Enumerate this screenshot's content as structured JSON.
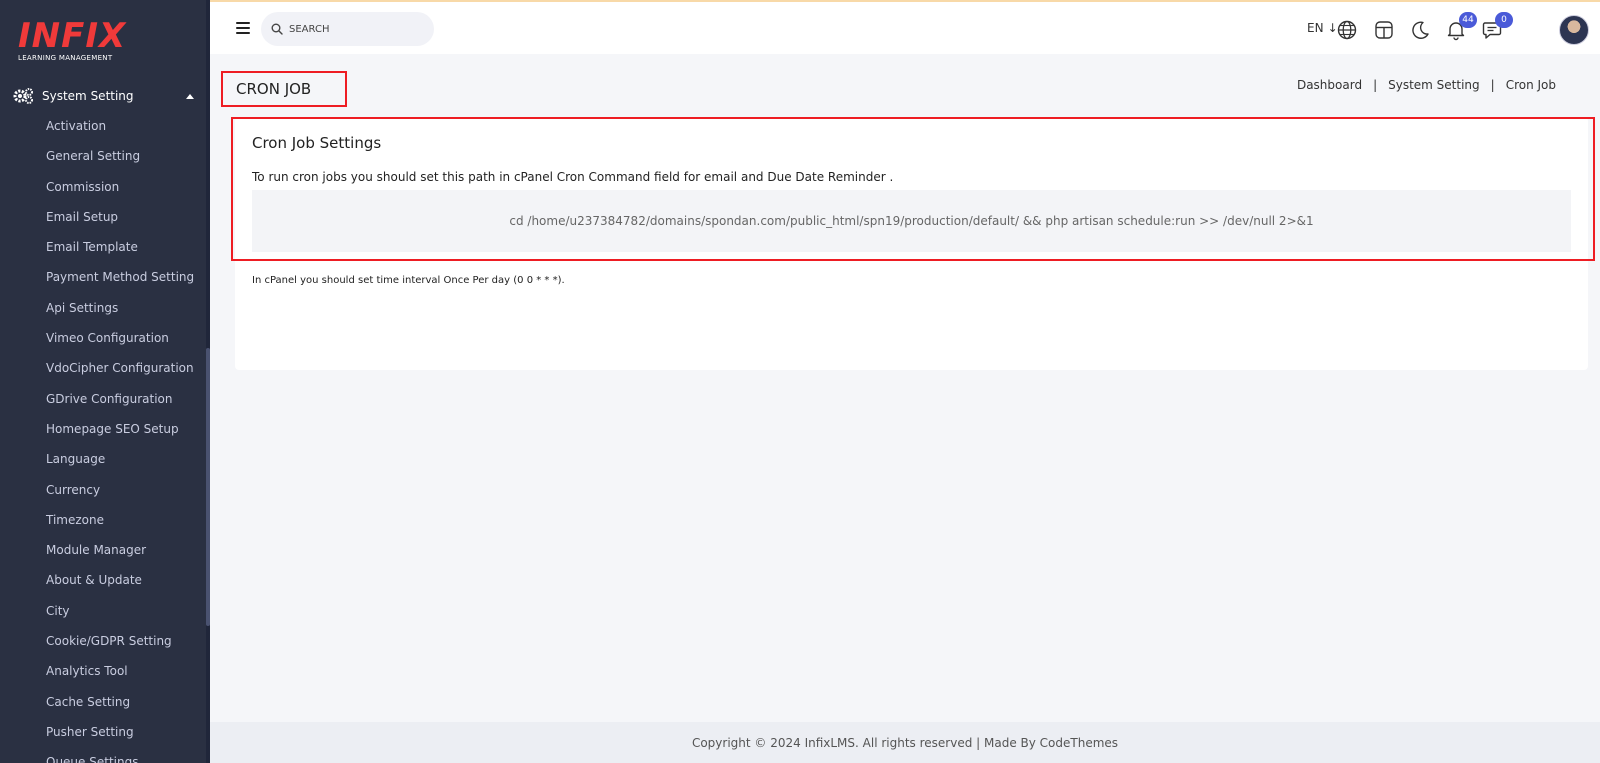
{
  "brand": {
    "logo_text": "INFIX",
    "logo_sub": "LEARNING MANAGEMENT"
  },
  "sidebar": {
    "section_label": "System Setting",
    "items": [
      "Activation",
      "General Setting",
      "Commission",
      "Email Setup",
      "Email Template",
      "Payment Method Setting",
      "Api Settings",
      "Vimeo Configuration",
      "VdoCipher Configuration",
      "GDrive Configuration",
      "Homepage SEO Setup",
      "Language",
      "Currency",
      "Timezone",
      "Module Manager",
      "About & Update",
      "City",
      "Cookie/GDPR Setting",
      "Analytics Tool",
      "Cache Setting",
      "Pusher Setting",
      "Queue Settings"
    ]
  },
  "topbar": {
    "search_placeholder": "SEARCH",
    "language": "EN",
    "notification_count": "44",
    "message_count": "0",
    "icons": [
      "menu-icon",
      "search-icon",
      "globe-icon",
      "layout-icon",
      "moon-icon",
      "bell-icon",
      "chat-icon"
    ]
  },
  "page": {
    "title": "CRON JOB",
    "breadcrumb": [
      "Dashboard",
      "System Setting",
      "Cron Job"
    ]
  },
  "card": {
    "title": "Cron Job Settings",
    "description": "To run cron jobs you should set this path in cPanel Cron Command field for email and Due Date Reminder .",
    "command": "cd /home/u237384782/domains/spondan.com/public_html/spn19/production/default/ && php artisan schedule:run >> /dev/null 2>&1",
    "note": "In cPanel you should set time interval Once Per day (0 0 * * *)."
  },
  "footer": {
    "text": "Copyright © 2024 InfixLMS. All rights reserved | Made By CodeThemes"
  },
  "colors": {
    "sidebar_bg": "#2a3042",
    "accent_red": "#ee1d23",
    "badge_blue": "#4a5ad8",
    "page_bg": "#f5f6f9"
  }
}
